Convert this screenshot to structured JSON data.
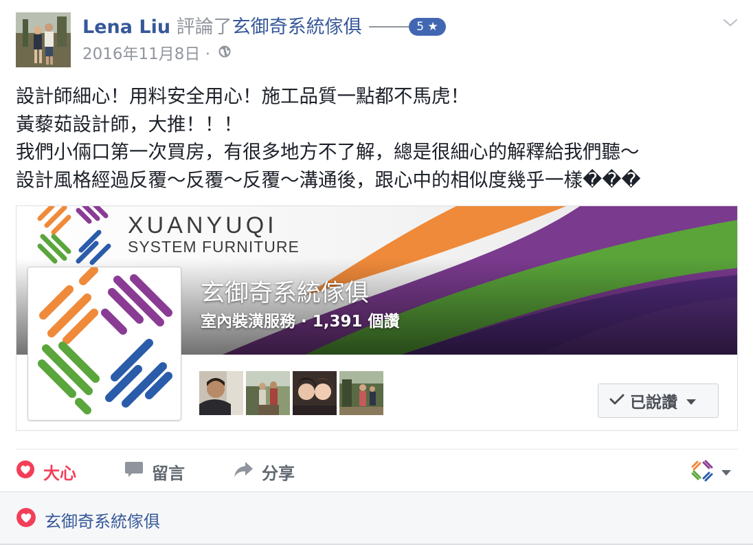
{
  "post": {
    "author": "Lena Liu",
    "action": "評論了",
    "page": "玄御奇系統傢俱",
    "rating": "5 ★",
    "date": "2016年11月8日",
    "separator": "·",
    "privacy_icon": "globe-icon",
    "menu_icon": "chevron-down-icon",
    "text_lines": [
      "設計師細心！用料安全用心！施工品質一點都不馬虎！",
      "黃藜茹設計師，大推！！！",
      "我們小倆口第一次買房，有很多地方不了解，總是很細心的解釋給我們聽～",
      "設計風格經過反覆～反覆～反覆～溝通後，跟心中的相似度幾乎一樣���"
    ]
  },
  "card": {
    "brand_name": "XUANYUQI",
    "brand_sub": "SYSTEM FURNITURE",
    "page_name": "玄御奇系統傢俱",
    "page_sub": "室內裝潢服務 · 1,391 個讚",
    "liked_button": "已說讚",
    "liked_icon": "check-icon",
    "friends_count": 4
  },
  "actions": {
    "love": "大心",
    "comment": "留言",
    "share": "分享",
    "love_icon": "heart-icon",
    "comment_icon": "comment-icon",
    "share_icon": "share-arrow-icon"
  },
  "footer": {
    "reactor": "玄御奇系統傢俱",
    "reaction_icon": "heart-icon"
  },
  "colors": {
    "link": "#365899",
    "love": "#f33e58",
    "muted": "#90949c",
    "badge": "#4267b2",
    "brand_orange": "#f08a3c",
    "brand_purple": "#8a3c94",
    "brand_green": "#5aa63c",
    "brand_blue": "#2a5caa"
  }
}
